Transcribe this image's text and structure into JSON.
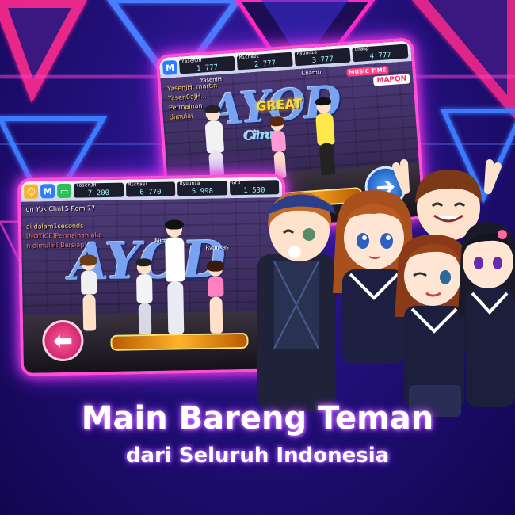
{
  "headline": "Main Bareng Teman",
  "subline": "dari Seluruh Indonesia",
  "colors": {
    "neon_pink": "#ff4fd8",
    "neon_blue": "#3b6dff",
    "background": "#22107a",
    "text_glow": "#a23bff"
  },
  "screenshot_back": {
    "hud_slots": [
      {
        "name": "YasenJH",
        "value": "1 777"
      },
      {
        "name": "Michael",
        "value": "2 777"
      },
      {
        "name": "Ryuunia",
        "value": "3 777"
      },
      {
        "name": "Champ",
        "value": "4 777"
      }
    ],
    "hud_icon": "M",
    "player_tag": "YasenJH",
    "player_tag_2": "Champ",
    "music_label": "MUSIC TIME",
    "mapon_label": "MAPON",
    "graffiti": "AYOD",
    "graffiti_sub": "Citrus",
    "great_label": "GREAT",
    "chat_lines": [
      "YasenJH: martin",
      "Yasen0aJH... ",
      "Permainan",
      "dimulai"
    ],
    "right_arrow_icon": "right-arrow-icon"
  },
  "screenshot_front": {
    "hud_icon": "M",
    "hud_slots": [
      {
        "name": "YasenJH",
        "value": "7 200"
      },
      {
        "name": "Michael",
        "value": "6 770"
      },
      {
        "name": "Ryuunia",
        "value": "5 998"
      },
      {
        "name": "Gro",
        "value": "1 530"
      }
    ],
    "room_line": "un Yuk Chnl 5 Rom 77",
    "chat_lines": [
      "ai dalam1seconds.",
      "[NOTICE]Permainan aka",
      "n dimulai! Bersiap!"
    ],
    "name_tags": [
      "Michael",
      "Ryuukas"
    ],
    "graffiti": "AYOD",
    "left_arrow_icon": "left-arrow-icon"
  }
}
